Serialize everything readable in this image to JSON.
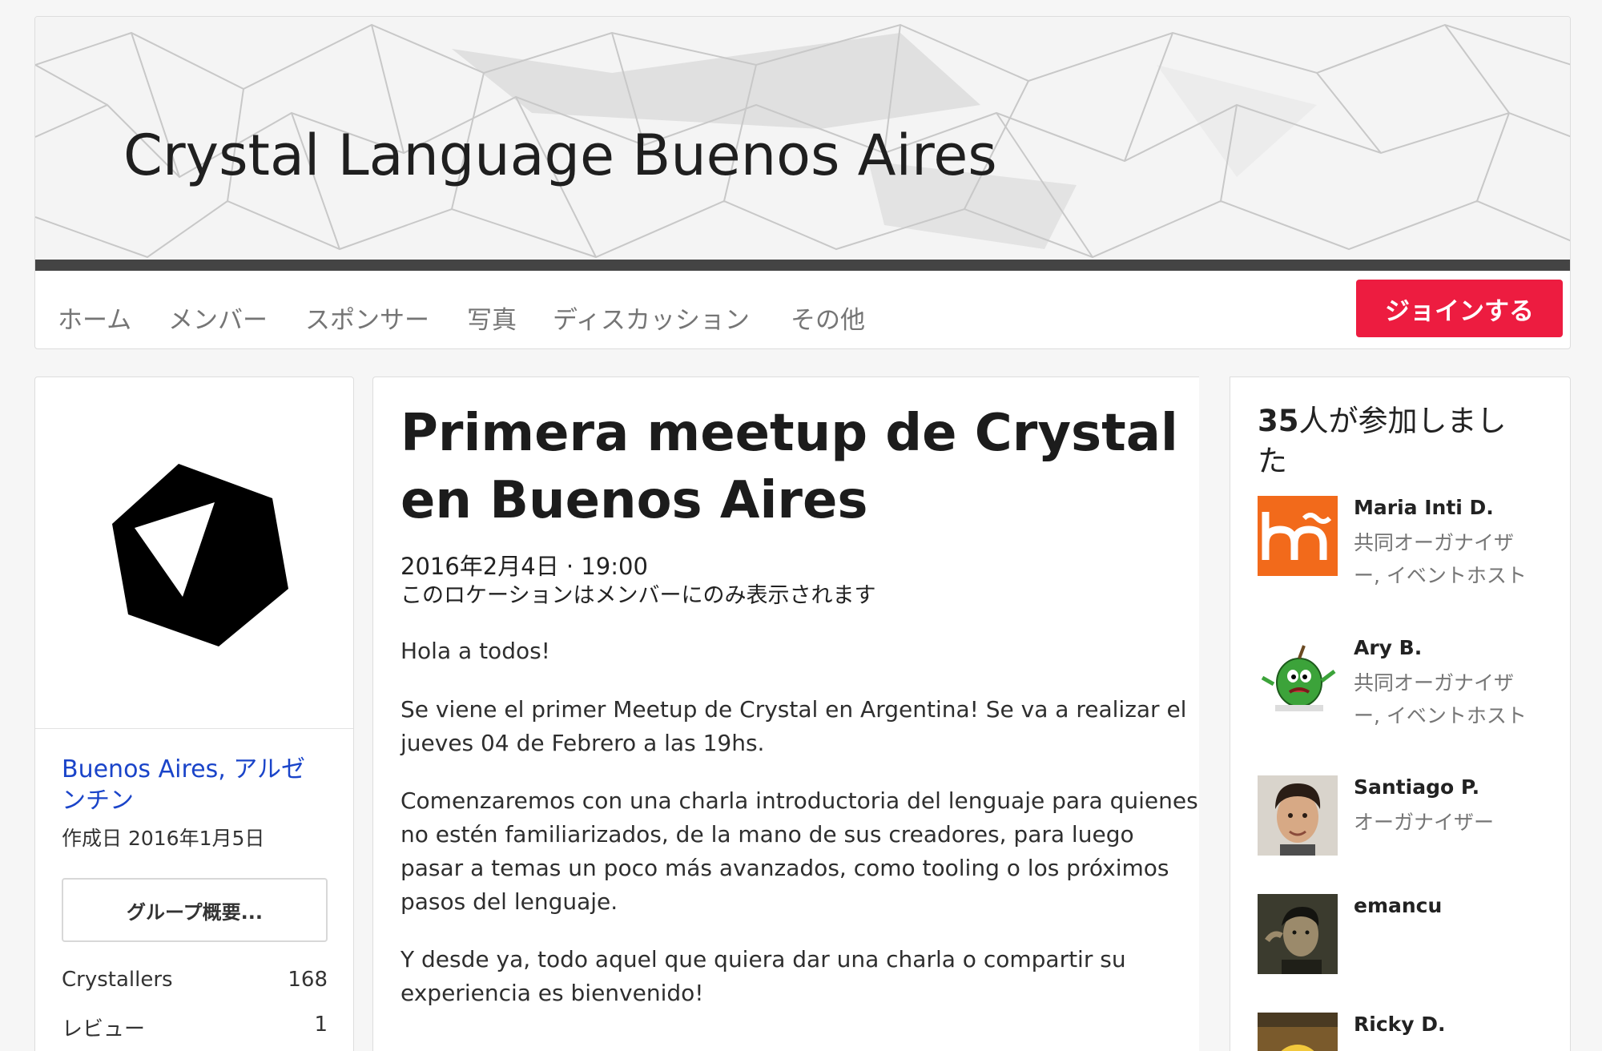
{
  "group": {
    "title": "Crystal Language Buenos Aires",
    "nav": [
      "ホーム",
      "メンバー",
      "スポンサー",
      "写真",
      "ディスカッション",
      "その他"
    ],
    "join_label": "ジョインする"
  },
  "sidebar": {
    "location": "Buenos Aires, アルゼンチン",
    "founded": "作成日 2016年1月5日",
    "overview_button": "グループ概要...",
    "stats": [
      {
        "label": "Crystallers",
        "value": "168"
      },
      {
        "label": "レビュー",
        "value": "1"
      }
    ]
  },
  "event": {
    "title": "Primera meetup de Crystal en Buenos Aires",
    "datetime": "2016年2月4日 · 19:00",
    "location_note": "このロケーションはメンバーにのみ表示されます",
    "paragraphs": [
      "Hola a todos!",
      "Se viene el primer Meetup de Crystal en Argentina! Se va a realizar el jueves 04 de Febrero a las 19hs.",
      "Comenzaremos con una charla introductoria del lenguaje para quienes no estén familiarizados, de la mano de sus creadores, para luego pasar a temas un poco más avanzados, como tooling o los próximos pasos del lenguaje.",
      "Y desde ya, todo aquel que quiera dar una charla o compartir su experiencia es bienvenido!"
    ]
  },
  "attendees": {
    "count": "35",
    "heading_suffix": "人が参加しました",
    "list": [
      {
        "name": "Maria Inti D.",
        "role": "共同オーガナイザー, イベントホスト",
        "avatar_icon": "logo-orange-icon"
      },
      {
        "name": "Ary B.",
        "role": "共同オーガナイザー, イベントホスト",
        "avatar_icon": "cartoon-apple-icon"
      },
      {
        "name": "Santiago P.",
        "role": "オーガナイザー",
        "avatar_icon": "person-photo"
      },
      {
        "name": "emancu",
        "role": "",
        "avatar_icon": "person-photo"
      },
      {
        "name": "Ricky D.",
        "role": "",
        "avatar_icon": "cartoon-photo"
      }
    ]
  },
  "colors": {
    "join": "#ed1c40",
    "link": "#1a44c9",
    "muted": "#757575",
    "avatar_orange": "#f26a1b"
  }
}
